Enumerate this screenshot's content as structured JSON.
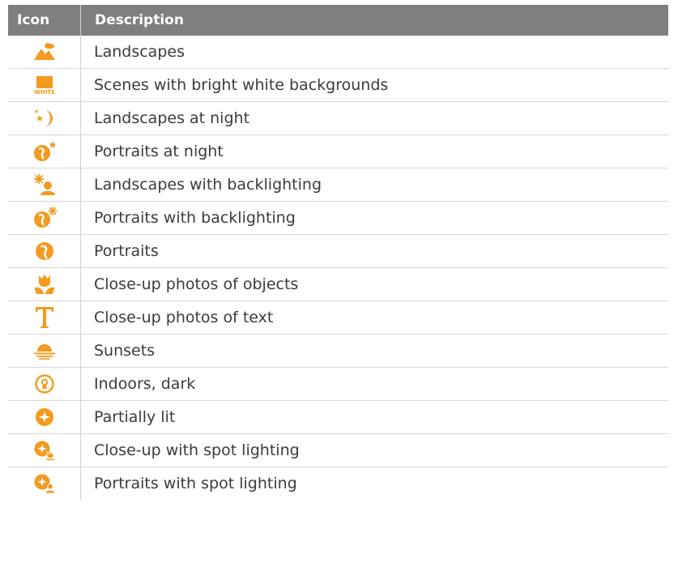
{
  "header": {
    "icon": "Icon",
    "description": "Description"
  },
  "accent_color": "#f39a1f",
  "rows": [
    {
      "icon": "landscape-icon",
      "description": "Landscapes"
    },
    {
      "icon": "white-background-icon",
      "icon_text": "WHITE",
      "description": "Scenes with bright white backgrounds"
    },
    {
      "icon": "night-landscape-icon",
      "description": "Landscapes at night"
    },
    {
      "icon": "night-portrait-icon",
      "description": "Portraits at night"
    },
    {
      "icon": "backlit-landscape-icon",
      "description": "Landscapes with backlighting"
    },
    {
      "icon": "backlit-portrait-icon",
      "description": "Portraits with backlighting"
    },
    {
      "icon": "portrait-icon",
      "description": "Portraits"
    },
    {
      "icon": "macro-flower-icon",
      "description": "Close-up photos of objects"
    },
    {
      "icon": "macro-text-icon",
      "description": "Close-up photos of text"
    },
    {
      "icon": "sunset-icon",
      "description": "Sunsets"
    },
    {
      "icon": "indoor-dark-icon",
      "description": "Indoors, dark"
    },
    {
      "icon": "partially-lit-icon",
      "description": "Partially lit"
    },
    {
      "icon": "spot-closeup-icon",
      "description": "Close-up with spot lighting"
    },
    {
      "icon": "spot-portrait-icon",
      "description": "Portraits with spot lighting"
    }
  ]
}
